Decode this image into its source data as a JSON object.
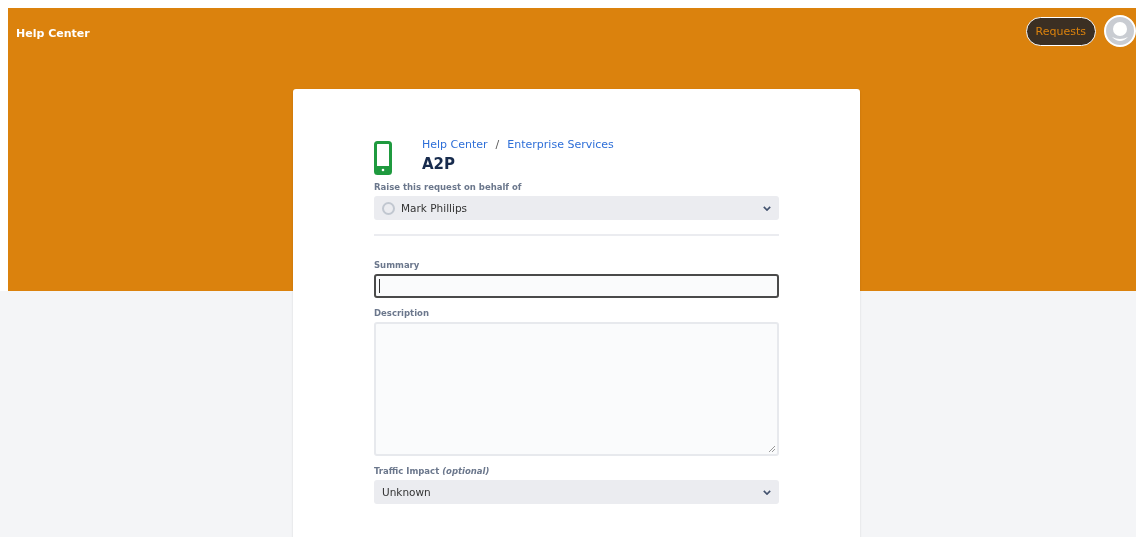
{
  "header": {
    "title": "Help Center",
    "requests_button": "Requests"
  },
  "breadcrumbs": [
    {
      "label": "Help Center"
    },
    {
      "label": "Enterprise Services"
    }
  ],
  "breadcrumb_separator": "/",
  "request_type": {
    "title": "A2P"
  },
  "fields": [
    {
      "kind": "select",
      "label": "Raise this request on behalf of",
      "value": "Mark Phillips",
      "with_avatar": true,
      "divider_after": true
    },
    {
      "kind": "text",
      "label": "Summary",
      "focused": true
    },
    {
      "kind": "textarea",
      "label": "Description",
      "focused": false
    },
    {
      "kind": "select",
      "label": "Traffic Impact *(optional)*",
      "value": "Unknown",
      "with_avatar": false
    }
  ]
}
